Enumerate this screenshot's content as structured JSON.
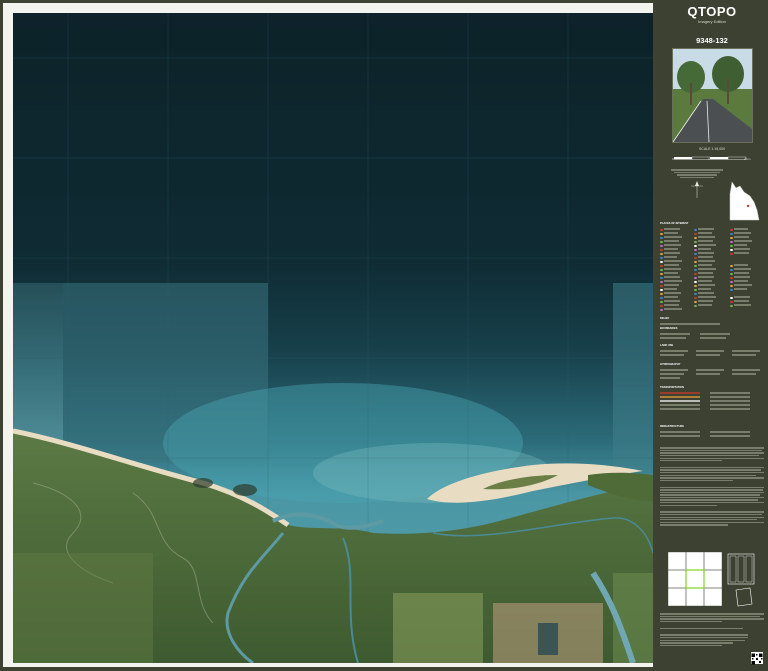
{
  "sidebar": {
    "title": "QTOPO",
    "subtitle": "Imagery Edition",
    "sheet_number": "9348-132",
    "scale_label": "SCALE 1:15,000",
    "scale_ticks": [
      "0",
      "1",
      "2 km"
    ],
    "legend_headings": [
      "PLACES OF INTEREST",
      "RELIEF",
      "BOUNDARIES",
      "LAND USE",
      "HYDROGRAPHY",
      "TRANSPORTATION",
      "INFRASTRUCTURE"
    ]
  },
  "map": {
    "content": "satellite imagery of a coastline with a sand spit, river estuary and green vegetated land"
  },
  "icons": {
    "qld_inset": "queensland-locator-icon",
    "qr": "qr-code-icon"
  },
  "colors": {
    "sidebar_bg": "#3c4132",
    "sea_deep": "#0f2b33",
    "sea_shallow": "#3f8fa0",
    "sand": "#e8dcc2",
    "vegetation": "#4d6b3a",
    "index_highlight": "#7fd321"
  }
}
